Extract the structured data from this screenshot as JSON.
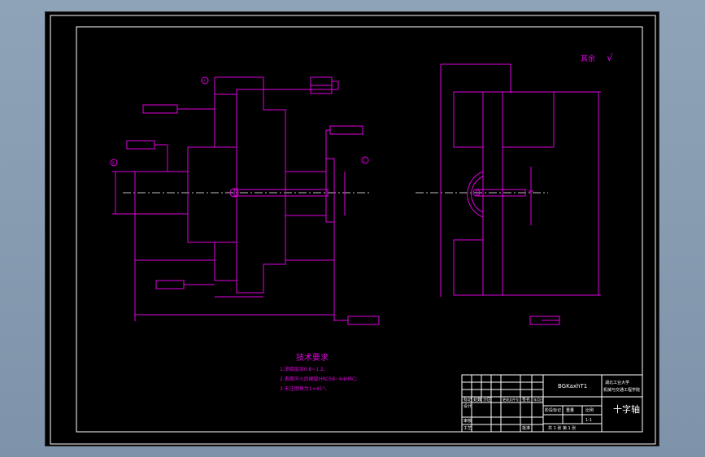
{
  "title_block": {
    "drawing_number": "BGKaxhT1",
    "school": "湖北工业大学",
    "school_line1": "湖北工业大学",
    "school_line2": "机械与交通工程学院",
    "part_name": "十字轴",
    "scale": "1:1",
    "sheet_info": "共 1 张   第 1 张",
    "header_cells": [
      "标记",
      "处数",
      "分区",
      "更改文件号",
      "签名",
      "年月日"
    ],
    "role_cells": [
      "设计",
      "审核",
      "工艺",
      "批准"
    ],
    "stage_labels": [
      "阶段标记",
      "重量",
      "比例"
    ]
  },
  "technical_requirements": {
    "heading": "技术要求",
    "items": [
      "1.渗碳层深0.8~1.2;",
      "2.表面淬火后硬度HRC58~64HRC;",
      "3.未注倒角为1×45°。"
    ]
  },
  "surface_finish_note": {
    "label": "其余",
    "symbol": "√"
  },
  "datum_labels": [
    "A",
    "B",
    "C"
  ]
}
